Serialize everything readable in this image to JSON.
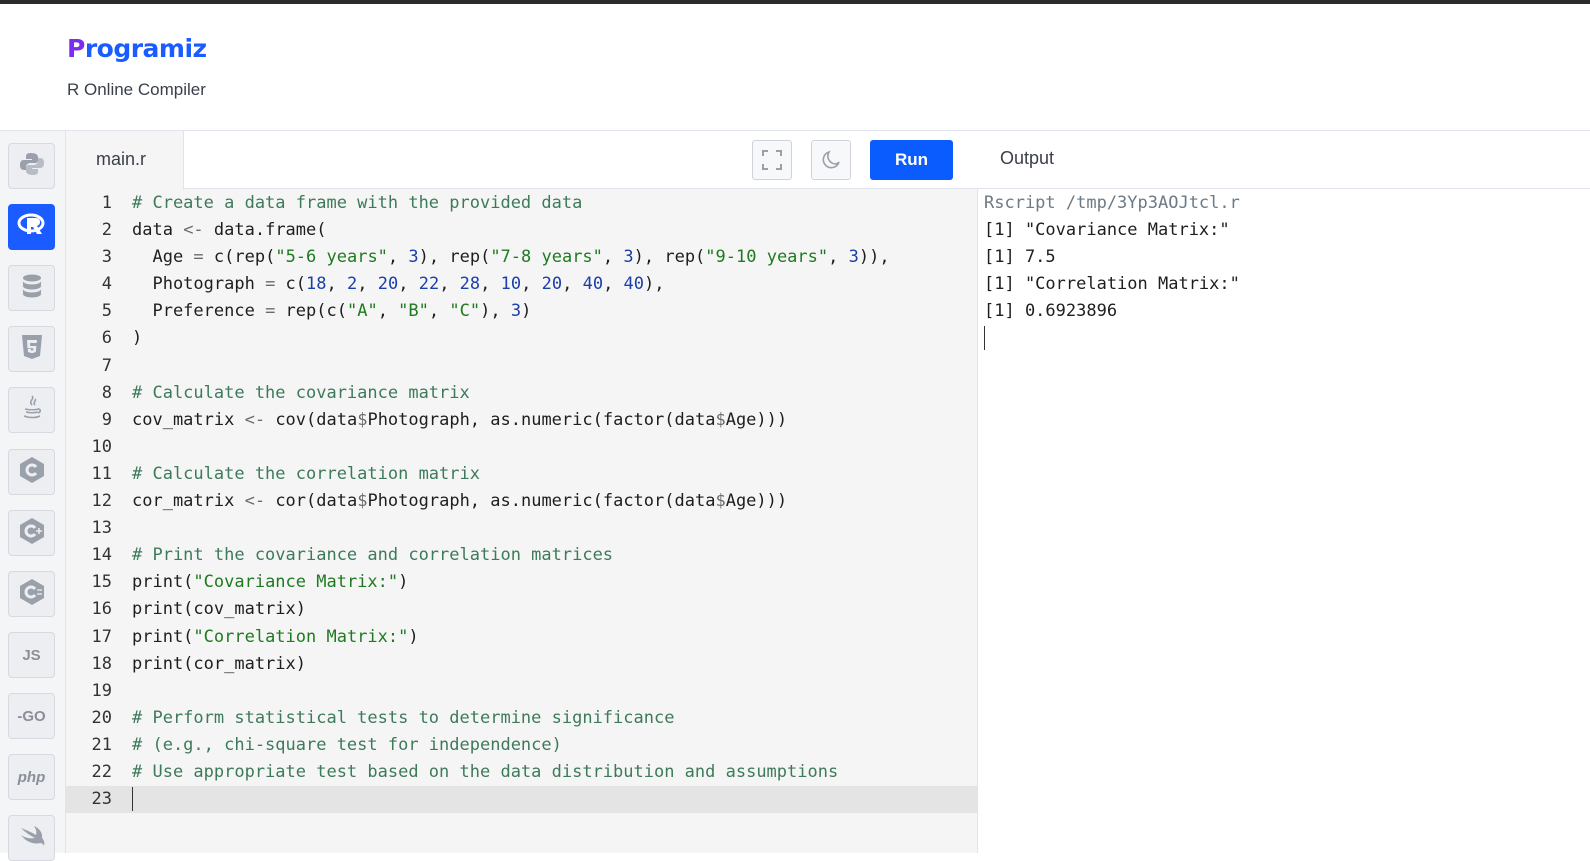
{
  "header": {
    "logo_initial": "P",
    "logo_rest": "rogramiz",
    "subtitle": "R Online Compiler"
  },
  "sidebar": {
    "languages": [
      {
        "name": "python-icon",
        "label": ""
      },
      {
        "name": "r-icon",
        "label": "",
        "active": true
      },
      {
        "name": "database-icon",
        "label": ""
      },
      {
        "name": "html5-icon",
        "label": ""
      },
      {
        "name": "java-icon",
        "label": ""
      },
      {
        "name": "c-icon",
        "label": ""
      },
      {
        "name": "cpp-icon",
        "label": ""
      },
      {
        "name": "csharp-icon",
        "label": ""
      },
      {
        "name": "js-icon",
        "label": "JS"
      },
      {
        "name": "go-icon",
        "label": "-GO"
      },
      {
        "name": "php-icon",
        "label": "php"
      },
      {
        "name": "swift-icon",
        "label": ""
      }
    ]
  },
  "editor": {
    "tab_label": "main.r",
    "run_label": "Run",
    "lines": [
      [
        [
          "cm",
          "# Create a data frame with the provided data"
        ]
      ],
      [
        [
          "tx",
          "data "
        ],
        [
          "op",
          "<-"
        ],
        [
          "tx",
          " data.frame("
        ]
      ],
      [
        [
          "tx",
          "  Age "
        ],
        [
          "op",
          "="
        ],
        [
          "tx",
          " c(rep("
        ],
        [
          "st",
          "\"5-6 years\""
        ],
        [
          "tx",
          ", "
        ],
        [
          "nm",
          "3"
        ],
        [
          "tx",
          "), rep("
        ],
        [
          "st",
          "\"7-8 years\""
        ],
        [
          "tx",
          ", "
        ],
        [
          "nm",
          "3"
        ],
        [
          "tx",
          "), rep("
        ],
        [
          "st",
          "\"9-10 years\""
        ],
        [
          "tx",
          ", "
        ],
        [
          "nm",
          "3"
        ],
        [
          "tx",
          ")),"
        ]
      ],
      [
        [
          "tx",
          "  Photograph "
        ],
        [
          "op",
          "="
        ],
        [
          "tx",
          " c("
        ],
        [
          "nm",
          "18"
        ],
        [
          "tx",
          ", "
        ],
        [
          "nm",
          "2"
        ],
        [
          "tx",
          ", "
        ],
        [
          "nm",
          "20"
        ],
        [
          "tx",
          ", "
        ],
        [
          "nm",
          "22"
        ],
        [
          "tx",
          ", "
        ],
        [
          "nm",
          "28"
        ],
        [
          "tx",
          ", "
        ],
        [
          "nm",
          "10"
        ],
        [
          "tx",
          ", "
        ],
        [
          "nm",
          "20"
        ],
        [
          "tx",
          ", "
        ],
        [
          "nm",
          "40"
        ],
        [
          "tx",
          ", "
        ],
        [
          "nm",
          "40"
        ],
        [
          "tx",
          "),"
        ]
      ],
      [
        [
          "tx",
          "  Preference "
        ],
        [
          "op",
          "="
        ],
        [
          "tx",
          " rep(c("
        ],
        [
          "st",
          "\"A\""
        ],
        [
          "tx",
          ", "
        ],
        [
          "st",
          "\"B\""
        ],
        [
          "tx",
          ", "
        ],
        [
          "st",
          "\"C\""
        ],
        [
          "tx",
          "), "
        ],
        [
          "nm",
          "3"
        ],
        [
          "tx",
          ")"
        ]
      ],
      [
        [
          "tx",
          ")"
        ]
      ],
      [],
      [
        [
          "cm",
          "# Calculate the covariance matrix"
        ]
      ],
      [
        [
          "tx",
          "cov_matrix "
        ],
        [
          "op",
          "<-"
        ],
        [
          "tx",
          " cov(data"
        ],
        [
          "op",
          "$"
        ],
        [
          "tx",
          "Photograph, as.numeric(factor(data"
        ],
        [
          "op",
          "$"
        ],
        [
          "tx",
          "Age)))"
        ]
      ],
      [],
      [
        [
          "cm",
          "# Calculate the correlation matrix"
        ]
      ],
      [
        [
          "tx",
          "cor_matrix "
        ],
        [
          "op",
          "<-"
        ],
        [
          "tx",
          " cor(data"
        ],
        [
          "op",
          "$"
        ],
        [
          "tx",
          "Photograph, as.numeric(factor(data"
        ],
        [
          "op",
          "$"
        ],
        [
          "tx",
          "Age)))"
        ]
      ],
      [],
      [
        [
          "cm",
          "# Print the covariance and correlation matrices"
        ]
      ],
      [
        [
          "tx",
          "print("
        ],
        [
          "st",
          "\"Covariance Matrix:\""
        ],
        [
          "tx",
          ")"
        ]
      ],
      [
        [
          "tx",
          "print(cov_matrix)"
        ]
      ],
      [
        [
          "tx",
          "print("
        ],
        [
          "st",
          "\"Correlation Matrix:\""
        ],
        [
          "tx",
          ")"
        ]
      ],
      [
        [
          "tx",
          "print(cor_matrix)"
        ]
      ],
      [],
      [
        [
          "cm",
          "# Perform statistical tests to determine significance"
        ]
      ],
      [
        [
          "cm",
          "# (e.g., chi-square test for independence)"
        ]
      ],
      [
        [
          "cm",
          "# Use appropriate test based on the data distribution and assumptions"
        ]
      ],
      []
    ],
    "current_line": 23
  },
  "output": {
    "title": "Output",
    "command": "Rscript /tmp/3Yp3AOJtcl.r",
    "lines": [
      "[1] \"Covariance Matrix:\"",
      "[1] 7.5",
      "[1] \"Correlation Matrix:\"",
      "[1] 0.6923896"
    ]
  }
}
